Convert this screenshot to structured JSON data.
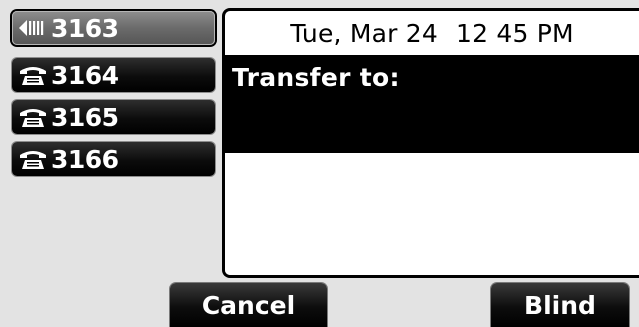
{
  "line_keys": [
    {
      "number": "3163",
      "icon": "active-call-icon",
      "state": "selected"
    },
    {
      "number": "3164",
      "icon": "phone-handset-icon",
      "state": "idle"
    },
    {
      "number": "3165",
      "icon": "phone-handset-icon",
      "state": "idle"
    },
    {
      "number": "3166",
      "icon": "phone-handset-icon",
      "state": "idle"
    }
  ],
  "status_bar": {
    "date": "Tue, Mar 24",
    "time": "12 45 PM"
  },
  "transfer": {
    "prompt": "Transfer to:",
    "dialed_value": ""
  },
  "softkeys": {
    "cancel_label": "Cancel",
    "blind_label": "Blind"
  },
  "colors": {
    "background": "#e3e3e3",
    "key_black": "#000000",
    "selected_key": "#707070",
    "text_white": "#ffffff"
  }
}
